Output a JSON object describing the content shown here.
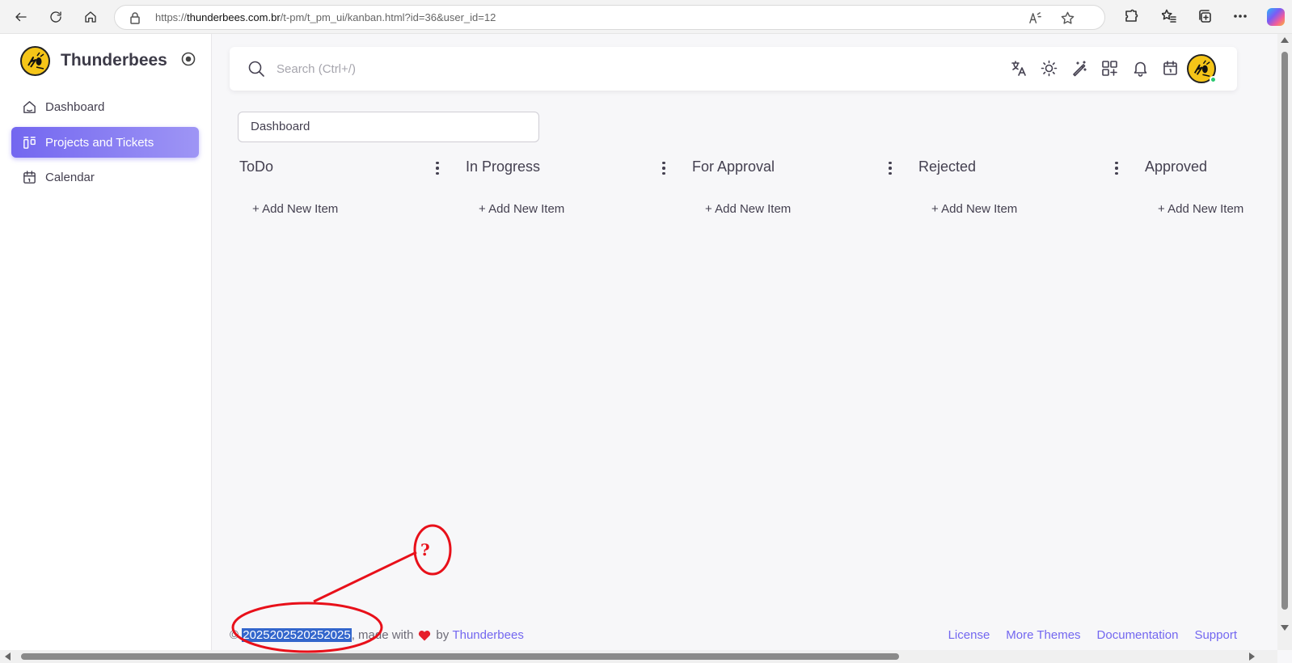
{
  "browser": {
    "url_prefix": "https://",
    "url_host": "thunderbees.com.br",
    "url_path": "/t-pm/t_pm_ui/kanban.html?id=36&user_id=12"
  },
  "sidebar": {
    "brand_name": "Thunderbees",
    "items": [
      {
        "label": "Dashboard",
        "icon": "smart-home-icon",
        "active": false
      },
      {
        "label": "Projects and Tickets",
        "icon": "layout-kanban-icon",
        "active": true
      },
      {
        "label": "Calendar",
        "icon": "calendar-icon",
        "active": false
      }
    ]
  },
  "navbar": {
    "search_placeholder": "Search (Ctrl+/)",
    "icons": [
      "translate-icon",
      "sun-icon",
      "magic-wand-icon",
      "apps-icon",
      "bell-icon",
      "calendar-icon"
    ]
  },
  "board": {
    "selected": "Dashboard"
  },
  "kanban": {
    "columns": [
      {
        "title": "ToDo",
        "add_label": "+ Add New Item"
      },
      {
        "title": "In Progress",
        "add_label": "+ Add New Item"
      },
      {
        "title": "For Approval",
        "add_label": "+ Add New Item"
      },
      {
        "title": "Rejected",
        "add_label": "+ Add New Item"
      },
      {
        "title": "Approved",
        "add_label": "+ Add New Item"
      }
    ]
  },
  "footer": {
    "copyright": "©",
    "year_text": "2025202520252025",
    "made_with": ", made with",
    "by": "by",
    "brand_link": "Thunderbees",
    "links": [
      "License",
      "More Themes",
      "Documentation",
      "Support"
    ]
  },
  "annotation": {
    "mark": "?"
  },
  "colors": {
    "primary": "#7367f0",
    "annotation_red": "#e8101a",
    "logo_yellow": "#f5c518",
    "online_green": "#28c76f"
  }
}
